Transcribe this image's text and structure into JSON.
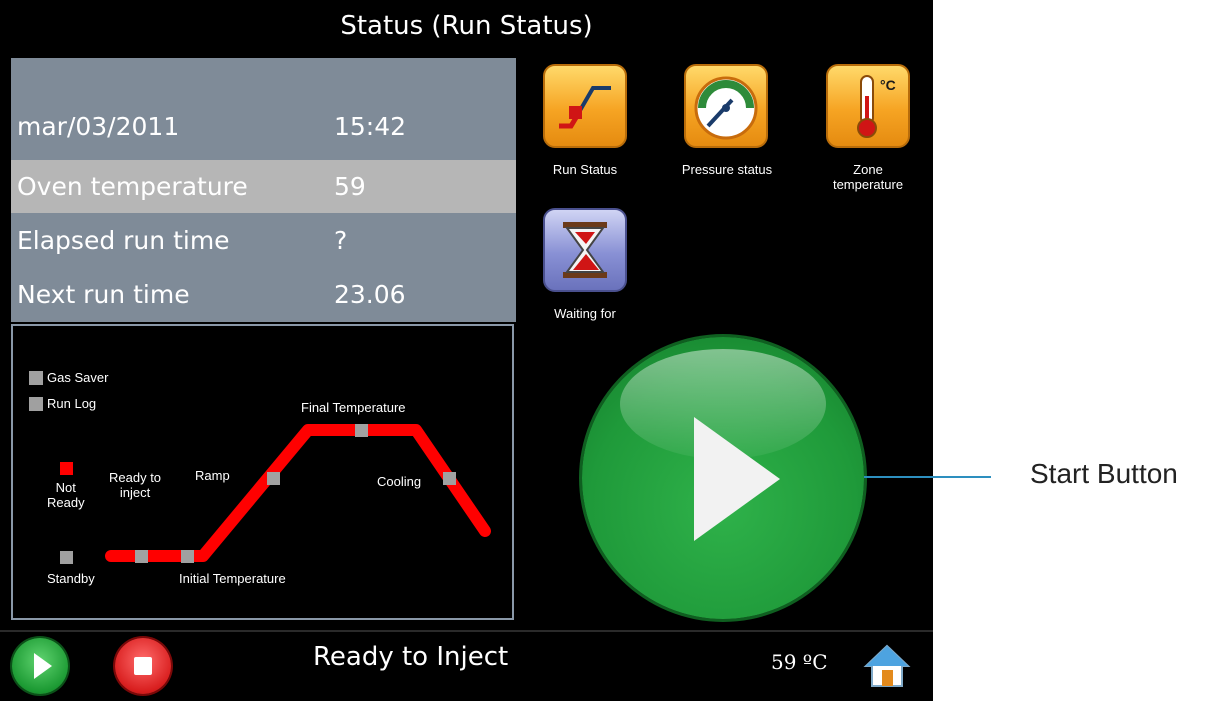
{
  "header": {
    "title": "Status (Run Status)"
  },
  "info": {
    "date": "mar/03/2011",
    "time": "15:42",
    "rows": [
      {
        "label": "Oven temperature",
        "value": "59"
      },
      {
        "label": "Elapsed run time",
        "value": "?"
      },
      {
        "label": "Next run time",
        "value": "23.06"
      }
    ]
  },
  "diagram": {
    "legend": [
      "Gas Saver",
      "Run Log"
    ],
    "labels": {
      "final_temperature": "Final Temperature",
      "ramp": "Ramp",
      "cooling": "Cooling",
      "not_ready": "Not\nReady",
      "ready_to_inject": "Ready to\ninject",
      "standby": "Standby",
      "initial_temperature": "Initial Temperature"
    },
    "colors": {
      "active": "#ff0000",
      "marker": "#a0a0a0"
    }
  },
  "icons": [
    {
      "name": "run-status-icon",
      "caption": "Run Status"
    },
    {
      "name": "pressure-status-icon",
      "caption": "Pressure status"
    },
    {
      "name": "zone-temperature-icon",
      "caption": "Zone\ntemperature"
    },
    {
      "name": "waiting-for-icon",
      "caption": "Waiting for"
    }
  ],
  "footer": {
    "status": "Ready to Inject",
    "temperature": "59 ºC"
  },
  "callout": {
    "label": "Start Button"
  }
}
